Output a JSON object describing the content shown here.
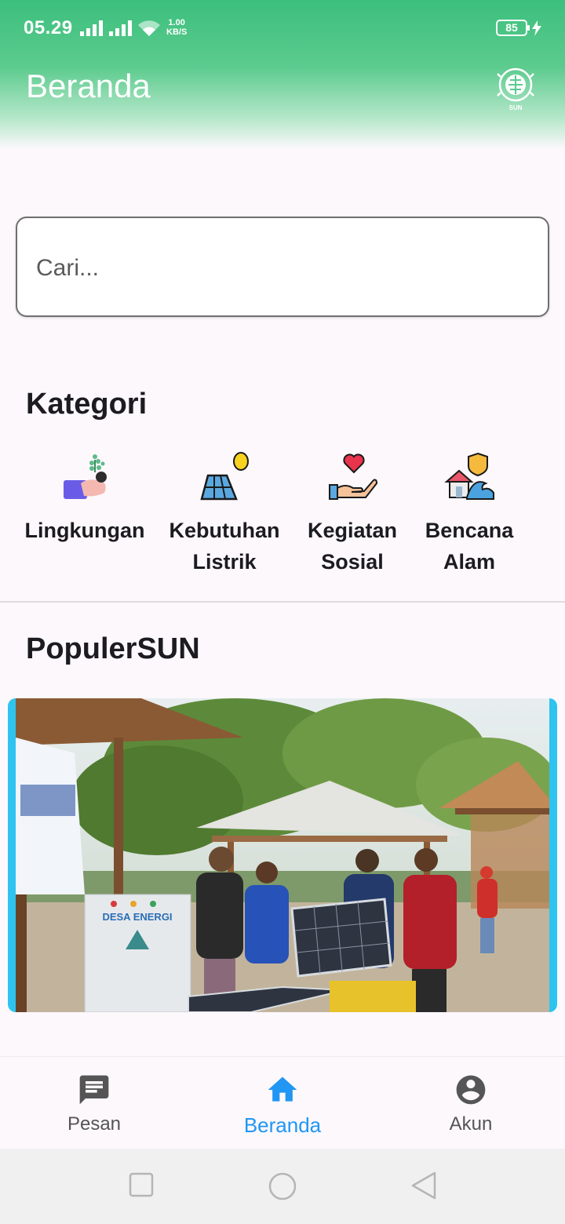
{
  "status_bar": {
    "time": "05.29",
    "net_speed_value": "1.00",
    "net_speed_unit": "KB/S",
    "battery": "85"
  },
  "header": {
    "title": "Beranda",
    "logo_text": "SUN"
  },
  "search": {
    "placeholder": "Cari..."
  },
  "categories": {
    "title": "Kategori",
    "items": [
      {
        "label": "Lingkungan",
        "icon": "plant-hand-icon"
      },
      {
        "label": "Kebutuhan Listrik",
        "icon": "solar-panel-icon"
      },
      {
        "label": "Kegiatan Sosial",
        "icon": "heart-hand-icon"
      },
      {
        "label": "Bencana Alam",
        "icon": "flood-house-icon"
      }
    ]
  },
  "popular": {
    "title": "PopulerSUN",
    "banner_sign_text": "DESA ENERGI"
  },
  "bottom_nav": {
    "items": [
      {
        "label": "Pesan",
        "icon": "message-icon"
      },
      {
        "label": "Beranda",
        "icon": "home-icon",
        "active": true
      },
      {
        "label": "Akun",
        "icon": "account-icon"
      }
    ]
  },
  "colors": {
    "header_green": "#3cbf7d",
    "active_blue": "#2196f3",
    "banner_border": "#2fc3ef"
  }
}
